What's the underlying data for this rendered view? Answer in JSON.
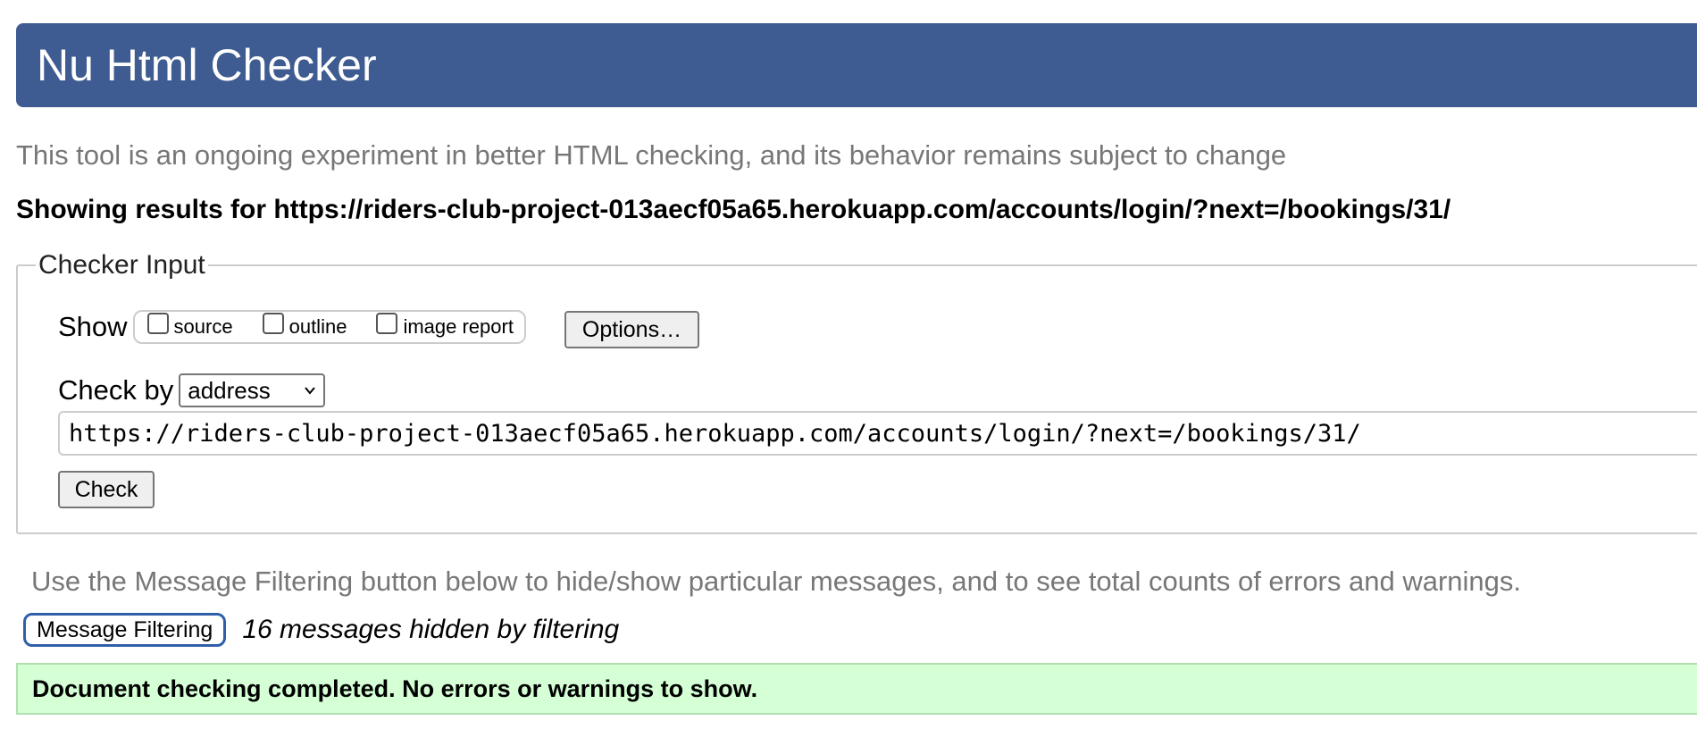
{
  "app_title": "Nu Html Checker",
  "intro_text": "This tool is an ongoing experiment in better HTML checking, and its behavior remains subject to change",
  "results_heading": "Showing results for https://riders-club-project-013aecf05a65.herokuapp.com/accounts/login/?next=/bookings/31/",
  "checker": {
    "legend": "Checker Input",
    "show_label": "Show",
    "show_options": [
      {
        "label": "source",
        "checked": false
      },
      {
        "label": "outline",
        "checked": false
      },
      {
        "label": "image report",
        "checked": false
      }
    ],
    "options_button": "Options…",
    "check_by_label": "Check by",
    "check_by_selected": "address",
    "url_value": "https://riders-club-project-013aecf05a65.herokuapp.com/accounts/login/?next=/bookings/31/",
    "check_button": "Check"
  },
  "filtering": {
    "note": "Use the Message Filtering button below to hide/show particular messages, and to see total counts of errors and warnings.",
    "button_label": "Message Filtering",
    "hidden_count_text": "16 messages hidden by filtering"
  },
  "status_message": "Document checking completed. No errors or warnings to show.",
  "colors": {
    "banner": "#3e5c91",
    "success_bg": "#d5ffd5",
    "filter_button_border": "#2f5fa8"
  }
}
